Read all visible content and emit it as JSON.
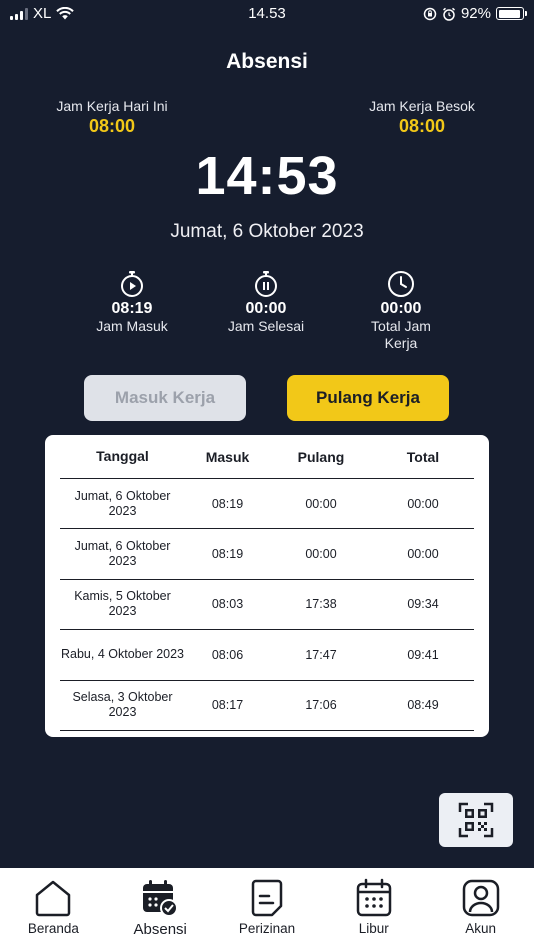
{
  "status_bar": {
    "carrier": "XL",
    "time": "14.53",
    "battery": "92%",
    "battery_level": 0.92
  },
  "header": {
    "title": "Absensi"
  },
  "work_today": {
    "label": "Jam Kerja Hari Ini",
    "value": "08:00"
  },
  "work_tomorrow": {
    "label": "Jam Kerja Besok",
    "value": "08:00"
  },
  "clock": {
    "time": "14:53",
    "date": "Jumat, 6 Oktober 2023"
  },
  "stats": [
    {
      "icon": "stopwatch-play-icon",
      "value": "08:19",
      "label": "Jam Masuk"
    },
    {
      "icon": "stopwatch-pause-icon",
      "value": "00:00",
      "label": "Jam Selesai"
    },
    {
      "icon": "clock-icon",
      "value": "00:00",
      "label": "Total Jam Kerja"
    }
  ],
  "buttons": {
    "masuk": "Masuk Kerja",
    "pulang": "Pulang Kerja"
  },
  "table": {
    "headers": [
      "Tanggal",
      "Masuk",
      "Pulang",
      "Total"
    ],
    "rows": [
      [
        "Jumat, 6 Oktober 2023",
        "08:19",
        "00:00",
        "00:00"
      ],
      [
        "Jumat, 6 Oktober 2023",
        "08:19",
        "00:00",
        "00:00"
      ],
      [
        "Kamis, 5 Oktober 2023",
        "08:03",
        "17:38",
        "09:34"
      ],
      [
        "Rabu, 4 Oktober 2023",
        "08:06",
        "17:47",
        "09:41"
      ],
      [
        "Selasa, 3 Oktober 2023",
        "08:17",
        "17:06",
        "08:49"
      ]
    ]
  },
  "qr_button": {
    "icon": "qr-scan-icon"
  },
  "nav": [
    {
      "label": "Beranda",
      "icon": "home-icon"
    },
    {
      "label": "Absensi",
      "icon": "calendar-check-icon",
      "active": true
    },
    {
      "label": "Perizinan",
      "icon": "document-icon"
    },
    {
      "label": "Libur",
      "icon": "calendar-icon"
    },
    {
      "label": "Akun",
      "icon": "user-icon"
    }
  ],
  "colors": {
    "background": "#161d2e",
    "accent": "#f2c818",
    "disabled": "#dfe2e8"
  }
}
